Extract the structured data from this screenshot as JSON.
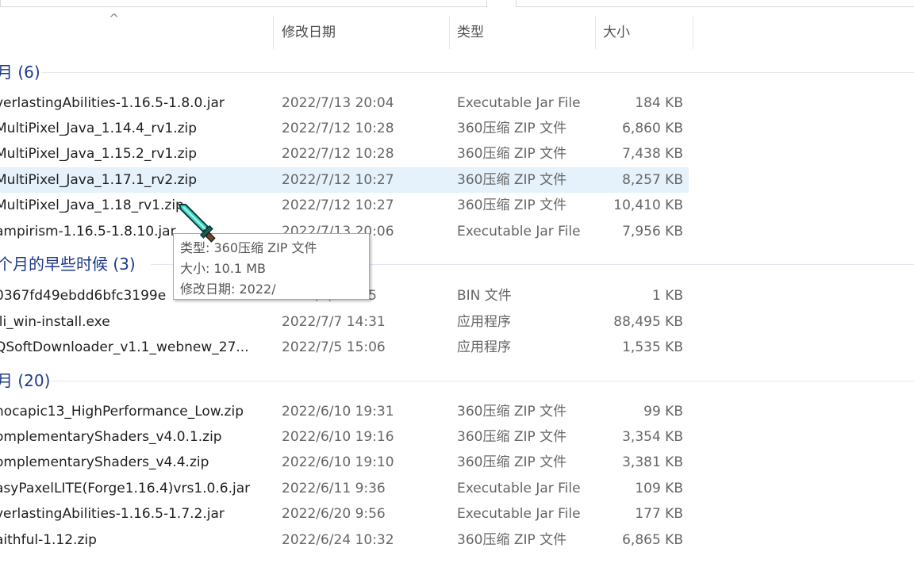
{
  "header": {
    "date_label": "修改日期",
    "type_label": "类型",
    "size_label": "大小"
  },
  "groups": [
    {
      "title": "月 (6)"
    },
    {
      "title": "个月的早些时候 (3)"
    },
    {
      "title": "月 (20)"
    }
  ],
  "rows": [
    {
      "name": "verlastingAbilities-1.16.5-1.8.0.jar",
      "date": "2022/7/13 20:04",
      "type": "Executable Jar File",
      "size": "184 KB"
    },
    {
      "name": "MultiPixel_Java_1.14.4_rv1.zip",
      "date": "2022/7/12 10:28",
      "type": "360压缩 ZIP 文件",
      "size": "6,860 KB"
    },
    {
      "name": "MultiPixel_Java_1.15.2_rv1.zip",
      "date": "2022/7/12 10:28",
      "type": "360压缩 ZIP 文件",
      "size": "7,438 KB"
    },
    {
      "name": "MultiPixel_Java_1.17.1_rv2.zip",
      "date": "2022/7/12 10:27",
      "type": "360压缩 ZIP 文件",
      "size": "8,257 KB",
      "selected": true
    },
    {
      "name": "MultiPixel_Java_1.18_rv1.zip",
      "date": "2022/7/12 10:27",
      "type": "360压缩 ZIP 文件",
      "size": "10,410 KB"
    },
    {
      "name": "ampirism-1.16.5-1.8.10.jar",
      "date": "2022/7/13 20:06",
      "type": "Executable Jar File",
      "size": "7,956 KB"
    },
    {
      "name": "0367fd49ebdd6bfc3199e",
      "date": "2022/7/  14:55",
      "type": "BIN 文件",
      "size": "1 KB"
    },
    {
      "name": "ili_win-install.exe",
      "date": "2022/7/7 14:31",
      "type": "应用程序",
      "size": "88,495 KB"
    },
    {
      "name": "QSoftDownloader_v1.1_webnew_27...",
      "date": "2022/7/5 15:06",
      "type": "应用程序",
      "size": "1,535 KB"
    },
    {
      "name": "hocapic13_HighPerformance_Low.zip",
      "date": "2022/6/10 19:31",
      "type": "360压缩 ZIP 文件",
      "size": "99 KB"
    },
    {
      "name": "omplementaryShaders_v4.0.1.zip",
      "date": "2022/6/10 19:16",
      "type": "360压缩 ZIP 文件",
      "size": "3,354 KB"
    },
    {
      "name": "omplementaryShaders_v4.4.zip",
      "date": "2022/6/10 19:10",
      "type": "360压缩 ZIP 文件",
      "size": "3,381 KB"
    },
    {
      "name": "asyPaxelLITE(Forge1.16.4)vrs1.0.6.jar",
      "date": "2022/6/11 9:36",
      "type": "Executable Jar File",
      "size": "109 KB"
    },
    {
      "name": "verlastingAbilities-1.16.5-1.7.2.jar",
      "date": "2022/6/20 9:56",
      "type": "Executable Jar File",
      "size": "177 KB"
    },
    {
      "name": "aithful-1.12.zip",
      "date": "2022/6/24 10:32",
      "type": "360压缩 ZIP 文件",
      "size": "6,865 KB"
    }
  ],
  "tooltip": {
    "type_line": "类型: 360压缩 ZIP 文件",
    "size_line": "大小: 10.1 MB",
    "date_line": "修改日期: 2022/"
  },
  "cursor": {
    "icon": "diamond-sword-cursor-icon"
  },
  "colors": {
    "group_title": "#1e3a8a",
    "selected_row": "#e5f1fb"
  }
}
